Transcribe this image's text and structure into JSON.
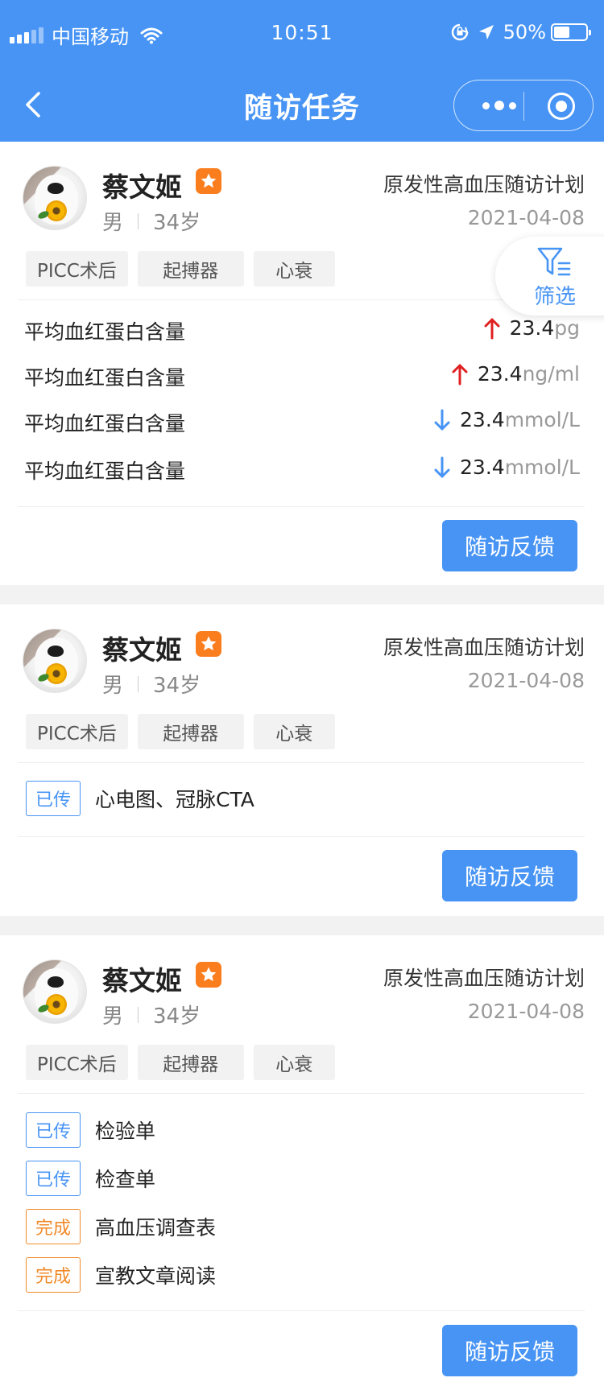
{
  "status_bar": {
    "carrier": "中国移动",
    "time": "10:51",
    "battery": "50%",
    "battery_level": 0.5
  },
  "nav": {
    "title": "随访任务",
    "back_icon": "chevron-left-icon",
    "more_icon": "more-dots-icon",
    "close_icon": "target-circle-icon"
  },
  "filter": {
    "label": "筛选",
    "icon": "filter-icon"
  },
  "colors": {
    "primary": "#4794f5",
    "star": "#fa7d1e",
    "up": "#e02020",
    "down": "#4794f5",
    "done": "#f08a2a"
  },
  "cards": [
    {
      "name": "蔡文姬",
      "gender": "男",
      "age": "34岁",
      "plan": "原发性高血压随访计划",
      "date": "2021-04-08",
      "tags": [
        "PICC术后",
        "起搏器",
        "心衰"
      ],
      "metrics": [
        {
          "label": "平均血红蛋白含量",
          "trend": "up",
          "value": "23.4",
          "unit": "pg"
        },
        {
          "label": "平均血红蛋白含量",
          "trend": "up",
          "value": "23.4",
          "unit": "ng/ml"
        },
        {
          "label": "平均血红蛋白含量",
          "trend": "down",
          "value": "23.4",
          "unit": "mmol/L"
        },
        {
          "label": "平均血红蛋白含量",
          "trend": "down",
          "value": "23.4",
          "unit": "mmol/L"
        }
      ],
      "button": "随访反馈"
    },
    {
      "name": "蔡文姬",
      "gender": "男",
      "age": "34岁",
      "plan": "原发性高血压随访计划",
      "date": "2021-04-08",
      "tags": [
        "PICC术后",
        "起搏器",
        "心衰"
      ],
      "items": [
        {
          "status": "已传",
          "text": "心电图、冠脉CTA"
        }
      ],
      "button": "随访反馈"
    },
    {
      "name": "蔡文姬",
      "gender": "男",
      "age": "34岁",
      "plan": "原发性高血压随访计划",
      "date": "2021-04-08",
      "tags": [
        "PICC术后",
        "起搏器",
        "心衰"
      ],
      "items": [
        {
          "status": "已传",
          "text": "检验单"
        },
        {
          "status": "已传",
          "text": "检查单"
        },
        {
          "status": "完成",
          "text": "高血压调查表"
        },
        {
          "status": "完成",
          "text": "宣教文章阅读"
        }
      ],
      "button": "随访反馈"
    }
  ]
}
